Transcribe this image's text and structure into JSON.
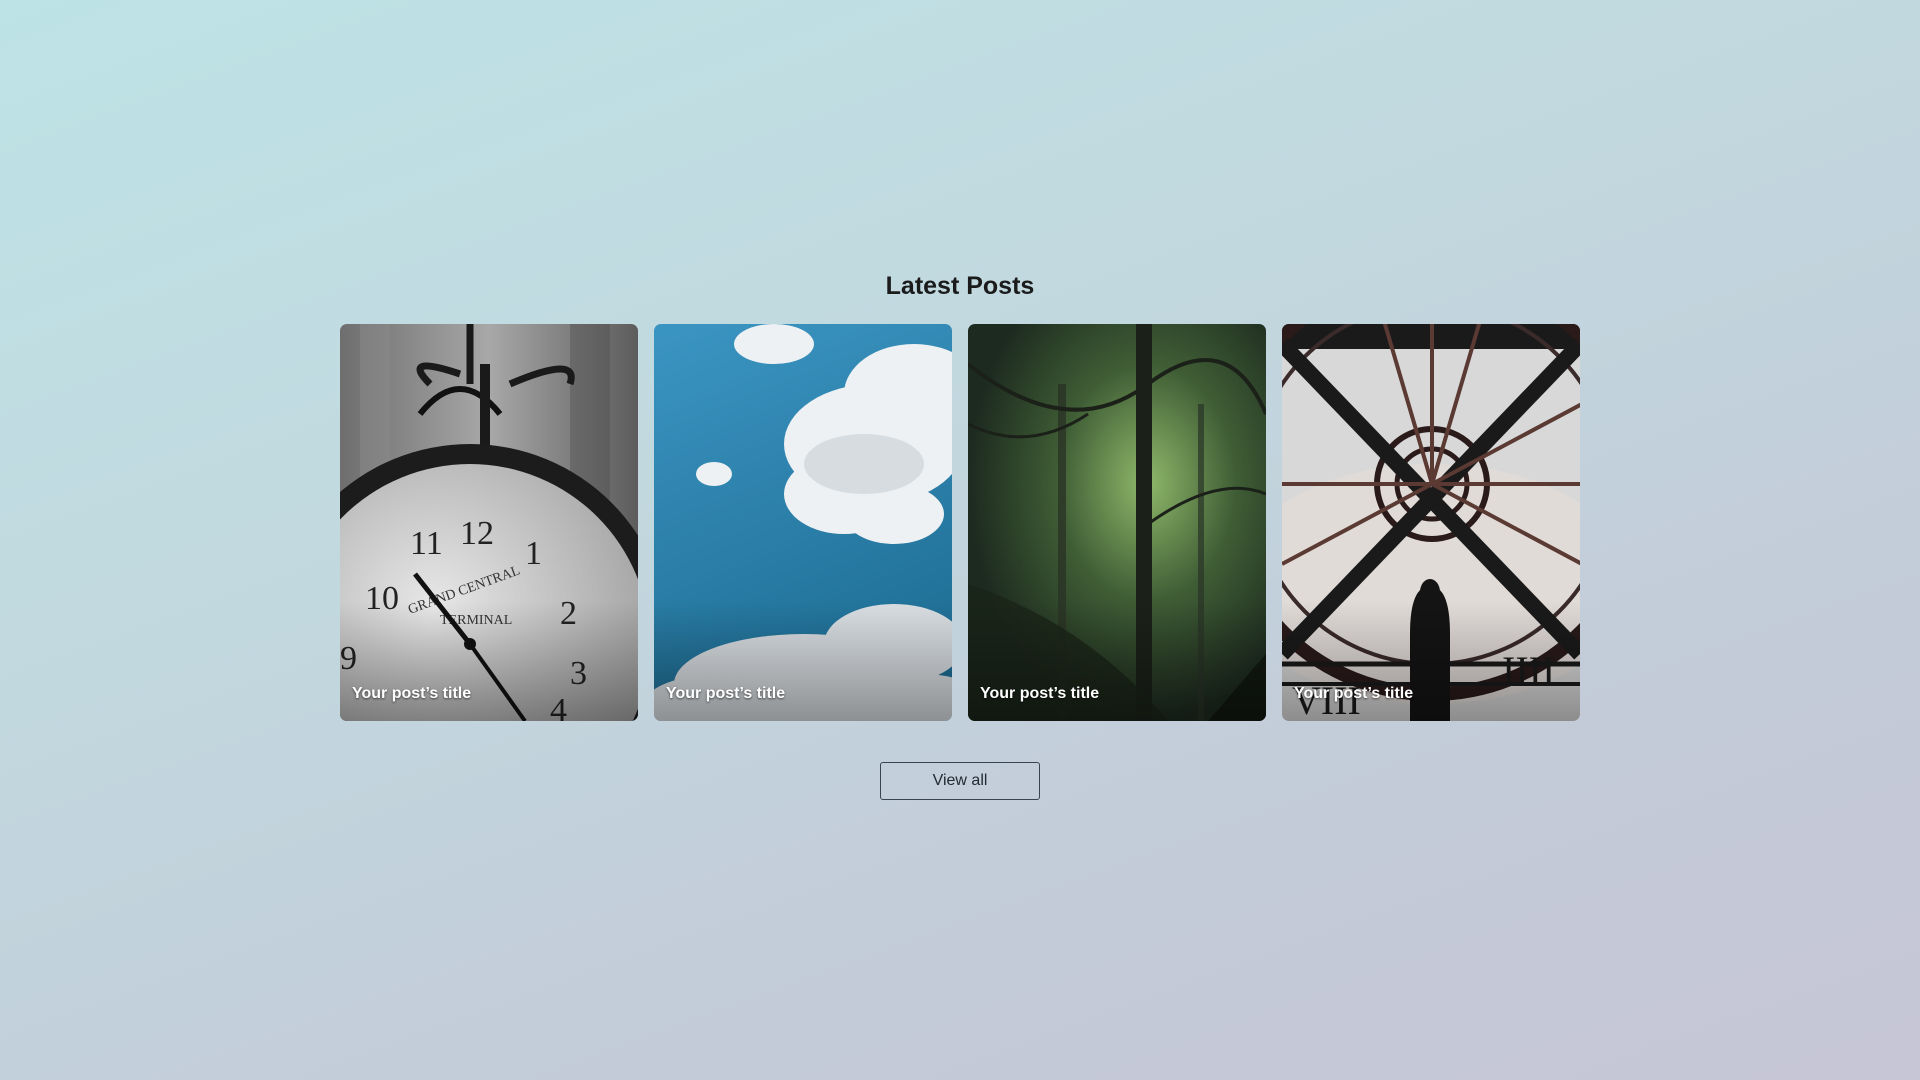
{
  "section": {
    "title": "Latest Posts"
  },
  "posts": [
    {
      "title": "Your post’s title",
      "image": "grand-central-clock"
    },
    {
      "title": "Your post’s title",
      "image": "clouds-sky"
    },
    {
      "title": "Your post’s title",
      "image": "misty-forest"
    },
    {
      "title": "Your post’s title",
      "image": "clock-window-silhouette"
    }
  ],
  "actions": {
    "view_all_label": "View all"
  },
  "colors": {
    "background_start": "#bde3e6",
    "background_end": "#c7c6d6",
    "title_text": "#1b1b1b",
    "card_title_text": "#ffffff",
    "button_border": "#3a4350"
  }
}
